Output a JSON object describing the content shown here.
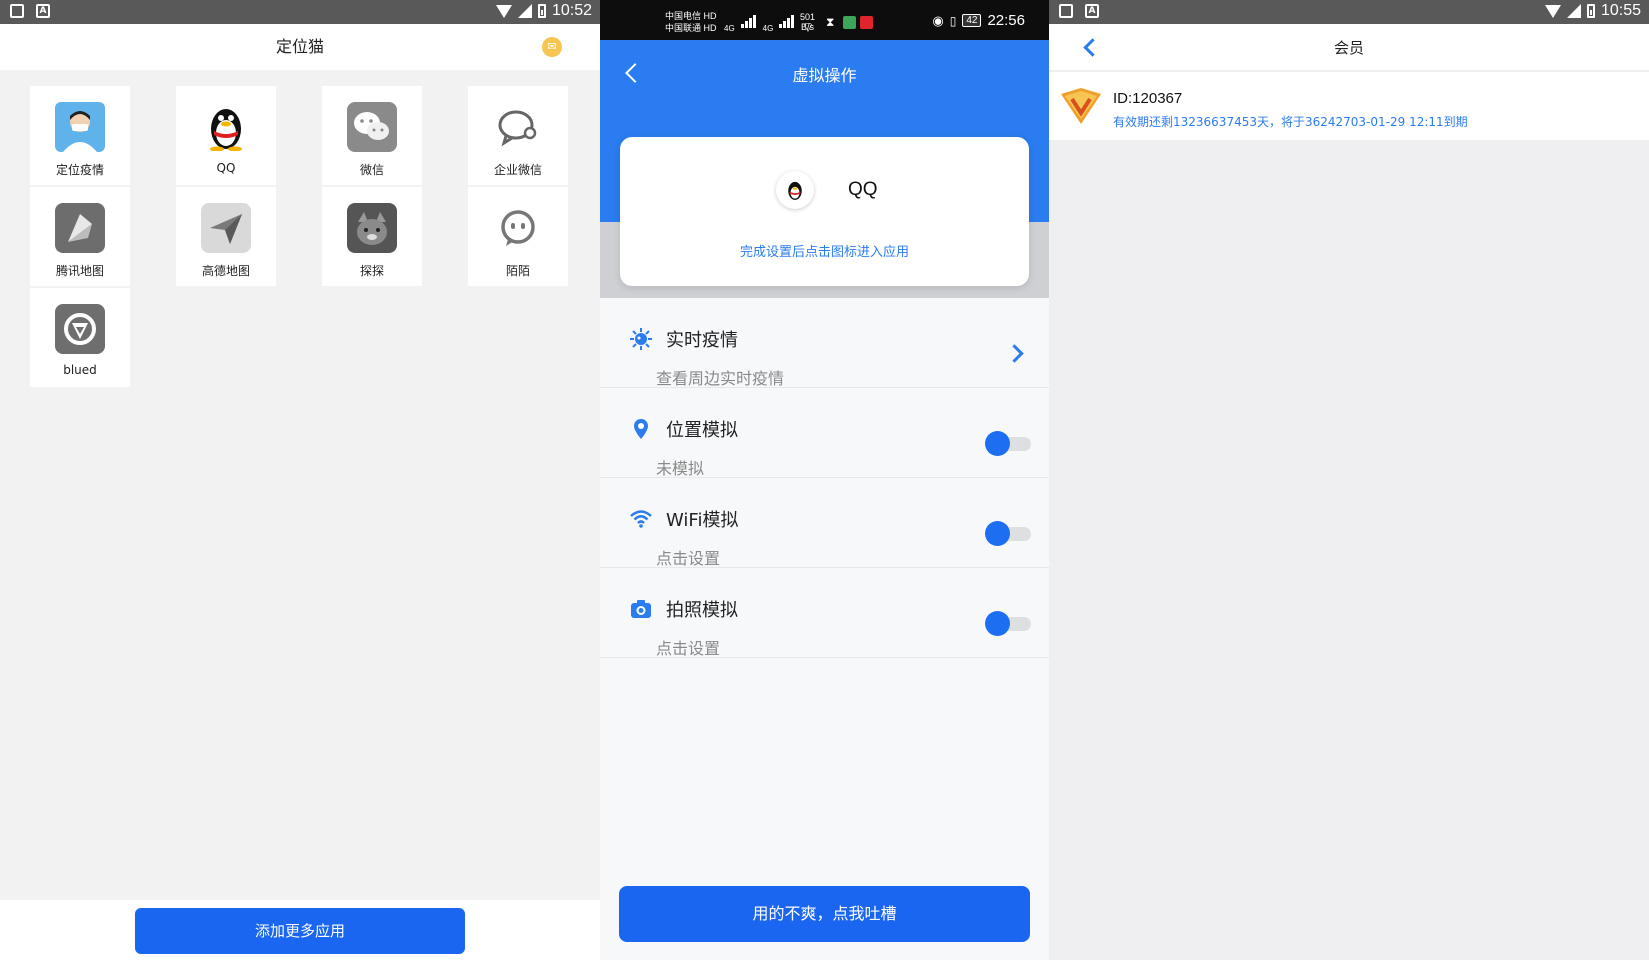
{
  "screen1": {
    "status_time": "10:52",
    "title": "定位猫",
    "apps": [
      {
        "label": "定位疫情",
        "icon": "doctor-icon"
      },
      {
        "label": "QQ",
        "icon": "qq-penguin-icon"
      },
      {
        "label": "微信",
        "icon": "wechat-icon"
      },
      {
        "label": "企业微信",
        "icon": "work-wechat-icon"
      },
      {
        "label": "腾讯地图",
        "icon": "tencent-map-icon"
      },
      {
        "label": "高德地图",
        "icon": "amap-icon"
      },
      {
        "label": "探探",
        "icon": "tantan-icon"
      },
      {
        "label": "陌陌",
        "icon": "momo-icon"
      },
      {
        "label": "blued",
        "icon": "blued-icon"
      }
    ],
    "add_button": "添加更多应用"
  },
  "screen2": {
    "status": {
      "carrier1": "中国电信",
      "carrier2": "中国联通",
      "hd": "HD",
      "net1": "4G",
      "net2": "4G",
      "speed_value": "501",
      "speed_unit": "B/s",
      "battery": "42",
      "time": "22:56"
    },
    "title": "虚拟操作",
    "app_name": "QQ",
    "hint": "完成设置后点击图标进入应用",
    "options": [
      {
        "title": "实时疫情",
        "subtitle": "查看周边实时疫情",
        "control": "arrow"
      },
      {
        "title": "位置模拟",
        "subtitle": "未模拟",
        "control": "toggle"
      },
      {
        "title": "WiFi模拟",
        "subtitle": "点击设置",
        "control": "toggle"
      },
      {
        "title": "拍照模拟",
        "subtitle": "点击设置",
        "control": "toggle"
      }
    ],
    "feedback_button": "用的不爽，点我吐槽"
  },
  "screen3": {
    "status_time": "10:55",
    "title": "会员",
    "member_id": "ID:120367",
    "expiry": "有效期还剩13236637453天，将于36242703-01-29 12:11到期"
  },
  "colors": {
    "accent": "#1a66f0",
    "header_blue": "#2b7cf0",
    "vip_orange": "#f0a02a"
  }
}
